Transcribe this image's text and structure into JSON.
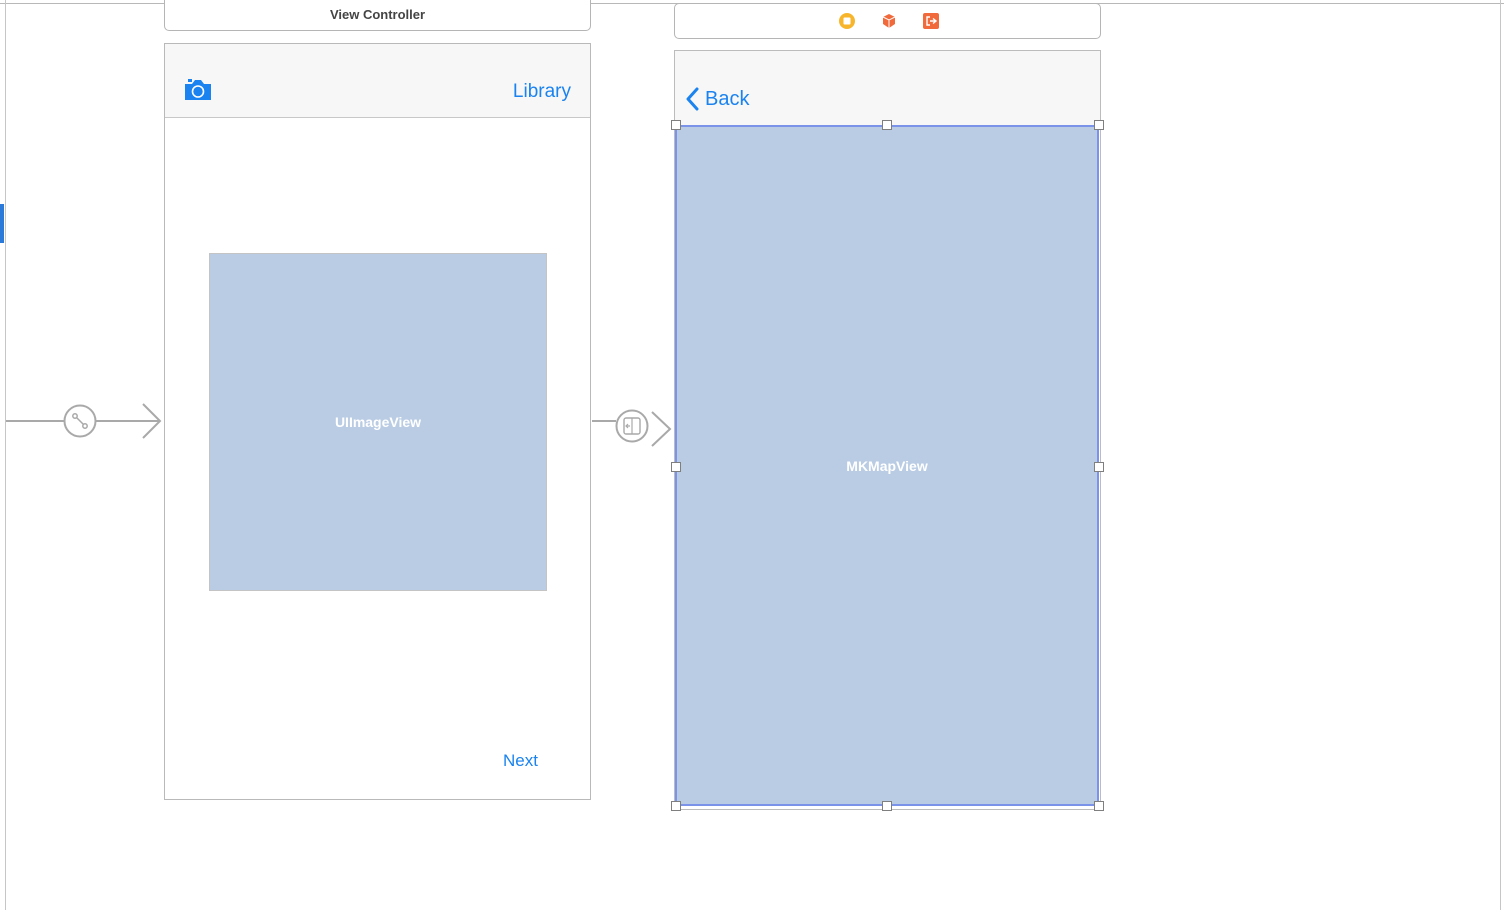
{
  "scenes": {
    "view_controller": {
      "title": "View Controller",
      "nav": {
        "left_icon": "camera-icon",
        "right_button": "Library"
      },
      "image_view_label": "UIImageView",
      "bottom_button": "Next"
    },
    "map_controller": {
      "header_icons": [
        "view-controller-icon",
        "first-responder-icon",
        "exit-icon"
      ],
      "nav": {
        "back_label": "Back"
      },
      "map_view_label": "MKMapView"
    }
  },
  "segues": [
    {
      "type": "entry-point",
      "icon": "segue-link-icon"
    },
    {
      "type": "show",
      "icon": "segue-show-icon"
    }
  ],
  "colors": {
    "tint": "#1a83f0",
    "placeholder_fill": "#b9cce4",
    "selection": "#7b93e8",
    "vc_icon": "#f7b52c",
    "responder_icon": "#f06a3c",
    "exit_icon": "#f06a3c"
  }
}
